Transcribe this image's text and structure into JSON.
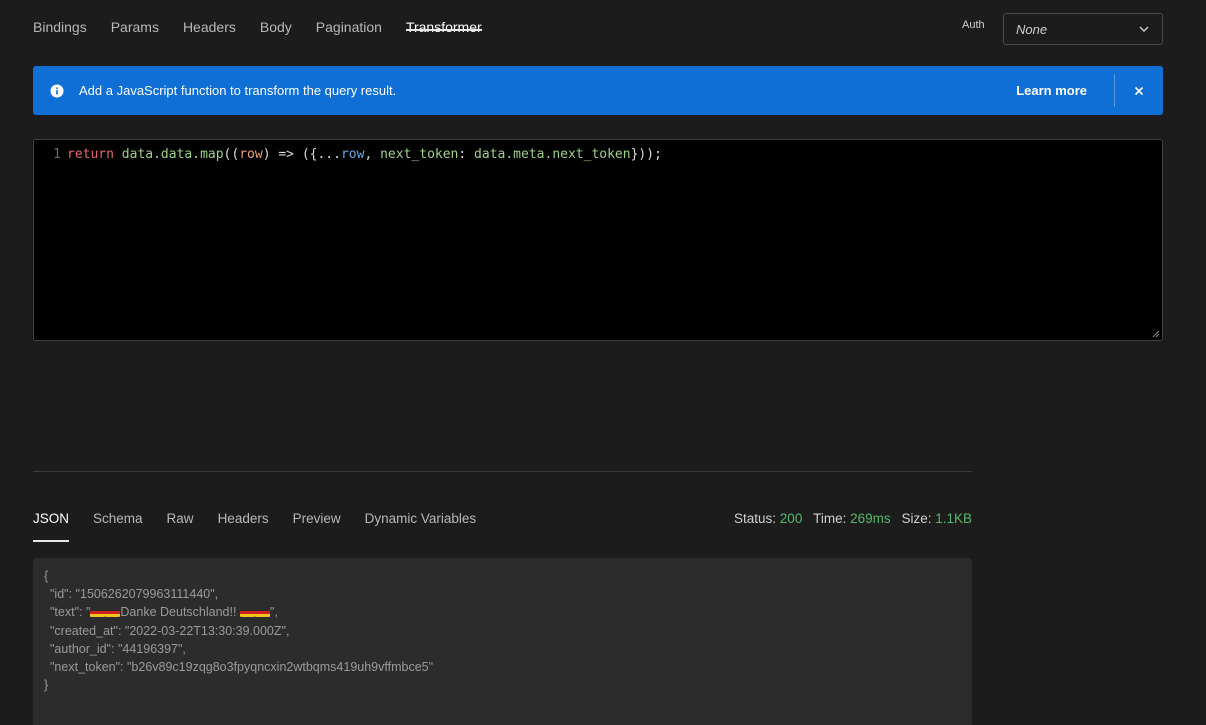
{
  "query_tabs": [
    "Bindings",
    "Params",
    "Headers",
    "Body",
    "Pagination",
    "Transformer"
  ],
  "active_query_tab": "Transformer",
  "auth": {
    "label": "Auth",
    "value": "None"
  },
  "banner": {
    "message": "Add a JavaScript function to transform the query result.",
    "learn_more": "Learn more",
    "close": "×",
    "color": "#0f6fd6"
  },
  "editor": {
    "line_number": "1",
    "tokens": [
      {
        "t": "return",
        "c": "kw"
      },
      {
        "t": " ",
        "c": "p"
      },
      {
        "t": "data.data.map",
        "c": "id"
      },
      {
        "t": "((",
        "c": "p"
      },
      {
        "t": "row",
        "c": "param"
      },
      {
        "t": ") => ({...",
        "c": "p"
      },
      {
        "t": "row",
        "c": "row"
      },
      {
        "t": ", ",
        "c": "p"
      },
      {
        "t": "next_token",
        "c": "id"
      },
      {
        "t": ": ",
        "c": "p"
      },
      {
        "t": "data.meta.next_token",
        "c": "id"
      },
      {
        "t": "}));",
        "c": "p"
      }
    ]
  },
  "response_tabs": [
    "JSON",
    "Schema",
    "Raw",
    "Headers",
    "Preview",
    "Dynamic Variables"
  ],
  "active_response_tab": "JSON",
  "stats": {
    "status_label": "Status:",
    "status_value": "200",
    "time_label": "Time:",
    "time_value": "269ms",
    "size_label": "Size:",
    "size_value": "1.1KB",
    "value_color": "#56b86c"
  },
  "json_output": {
    "open": "{",
    "id_line": "\"id\": \"1506262079963111440\",",
    "text_prefix": "\"text\": \"",
    "text_middle": "Danke Deutschland!! ",
    "text_suffix": "\",",
    "flag_icon": "germany-flag-emoji",
    "created_line": "\"created_at\": \"2022-03-22T13:30:39.000Z\",",
    "author_line": "\"author_id\": \"44196397\",",
    "token_line": "\"next_token\": \"b26v89c19zqg8o3fpyqncxin2wtbqms419uh9vffmbce5\"",
    "close": "}"
  }
}
